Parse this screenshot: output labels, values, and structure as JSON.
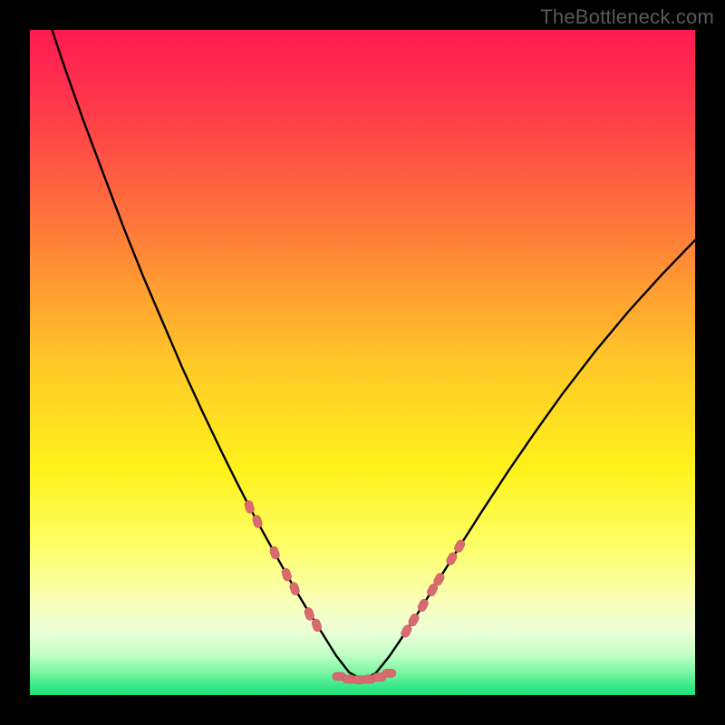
{
  "watermark": "TheBottleneck.com",
  "colors": {
    "black": "#000000",
    "curve": "#000000",
    "marker_fill": "#d96b70",
    "marker_stroke": "#c95a60",
    "gradient_stops": [
      {
        "offset": 0.0,
        "color": "#ff1a52"
      },
      {
        "offset": 0.12,
        "color": "#ff3a4a"
      },
      {
        "offset": 0.3,
        "color": "#ff7a3a"
      },
      {
        "offset": 0.5,
        "color": "#ffc828"
      },
      {
        "offset": 0.66,
        "color": "#fff21a"
      },
      {
        "offset": 0.78,
        "color": "#fdff6a"
      },
      {
        "offset": 0.86,
        "color": "#f8ffb8"
      },
      {
        "offset": 0.905,
        "color": "#ecffd8"
      },
      {
        "offset": 0.94,
        "color": "#bfffc4"
      },
      {
        "offset": 0.965,
        "color": "#7cf7a2"
      },
      {
        "offset": 0.985,
        "color": "#3de98a"
      },
      {
        "offset": 1.0,
        "color": "#1fe27d"
      }
    ]
  },
  "chart_data": {
    "type": "line",
    "title": "",
    "xlabel": "",
    "ylabel": "",
    "xlim": [
      0,
      100
    ],
    "ylim": [
      0,
      100
    ],
    "grid": false,
    "x": [
      0,
      2,
      5,
      8,
      11,
      14,
      17,
      20,
      23,
      26,
      29,
      31,
      33,
      35,
      37,
      38.5,
      40,
      41.5,
      43,
      44.5,
      46,
      48,
      50,
      52,
      54,
      55.5,
      57,
      58.5,
      60,
      62,
      65,
      68,
      72,
      76,
      80,
      85,
      90,
      95,
      100
    ],
    "y": [
      110,
      104,
      95,
      86.5,
      78.5,
      70.5,
      63,
      56,
      49,
      42.5,
      36.2,
      32.2,
      28.3,
      24.6,
      21,
      18.3,
      15.7,
      13.2,
      10.8,
      8.4,
      6.0,
      3.4,
      2.3,
      3.3,
      5.8,
      8.0,
      10.3,
      12.6,
      15.0,
      18.2,
      23.0,
      27.7,
      33.8,
      39.6,
      45.2,
      51.7,
      57.7,
      63.2,
      68.4
    ],
    "series": [
      {
        "name": "curve",
        "note": "V-shaped bottleneck curve; y is percent (distance from bottom), x is percent across. Values estimated from pixels."
      }
    ],
    "markers_left": [
      {
        "x": 33.0,
        "y": 28.3
      },
      {
        "x": 34.2,
        "y": 26.1
      },
      {
        "x": 36.8,
        "y": 21.4
      },
      {
        "x": 38.6,
        "y": 18.1
      },
      {
        "x": 39.8,
        "y": 16.0
      },
      {
        "x": 42.0,
        "y": 12.2
      },
      {
        "x": 43.1,
        "y": 10.5
      }
    ],
    "markers_right": [
      {
        "x": 56.6,
        "y": 9.6
      },
      {
        "x": 57.7,
        "y": 11.3
      },
      {
        "x": 59.1,
        "y": 13.5
      },
      {
        "x": 60.5,
        "y": 15.8
      },
      {
        "x": 61.5,
        "y": 17.4
      },
      {
        "x": 63.4,
        "y": 20.5
      },
      {
        "x": 64.6,
        "y": 22.4
      }
    ],
    "markers_bottom": [
      {
        "x": 46.5,
        "y": 2.8
      },
      {
        "x": 48.0,
        "y": 2.4
      },
      {
        "x": 49.5,
        "y": 2.3
      },
      {
        "x": 51.0,
        "y": 2.4
      },
      {
        "x": 52.5,
        "y": 2.7
      },
      {
        "x": 54.0,
        "y": 3.3
      }
    ]
  }
}
